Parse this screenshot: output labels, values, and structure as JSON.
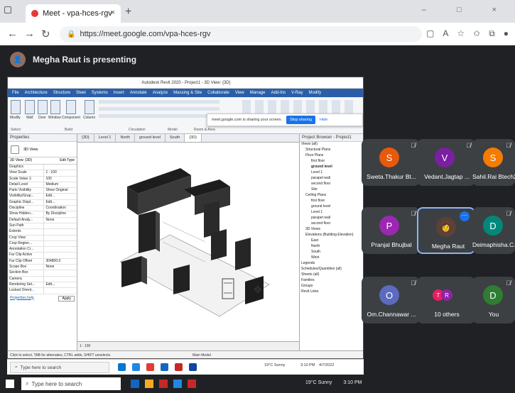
{
  "browser": {
    "tab_title": "Meet - vpa-hces-rgv",
    "tab_close": "×",
    "new_tab": "+",
    "window_controls": "– □ ×",
    "url": "https://meet.google.com/vpa-hces-rgv"
  },
  "meet": {
    "presenting_label": "Megha Raut is presenting",
    "participants": [
      {
        "name": "Sweta.Thakur Bt...",
        "initial": "S",
        "color": "#e8590c"
      },
      {
        "name": "Vedant.Jagtap ...",
        "initial": "V",
        "color": "#7b1fa2"
      },
      {
        "name": "Sahil.Rai Btech2...",
        "initial": "S",
        "color": "#f57c00"
      },
      {
        "name": "Pranjal Bhujbal",
        "initial": "P",
        "color": "#9c27b0"
      },
      {
        "name": "Megha Raut",
        "initial": "",
        "color": "#5d4037"
      },
      {
        "name": "Deimaphisha.C...",
        "initial": "D",
        "color": "#00897b"
      },
      {
        "name": "Om.Channawar ...",
        "initial": "O",
        "color": "#5c6bc0"
      },
      {
        "name": "10 others",
        "initial": "",
        "color": "#8e24aa"
      },
      {
        "name": "You",
        "initial": "D",
        "color": "#2e7d32"
      }
    ],
    "others_initials": [
      "T",
      "R"
    ]
  },
  "shared": {
    "app_title": "Autodesk Revit 2020 - Project1 - 3D View: {3D}",
    "menu": [
      "File",
      "Architecture",
      "Structure",
      "Steel",
      "Systems",
      "Insert",
      "Annotate",
      "Analyze",
      "Massing & Site",
      "Collaborate",
      "View",
      "Manage",
      "Add-Ins",
      "V-Ray",
      "Modify"
    ],
    "ribbon_buttons": [
      "Modify",
      "Wall",
      "Door",
      "Window",
      "Component",
      "Column"
    ],
    "ribbon_groups": [
      "Select",
      "Build",
      "Circulation",
      "Model",
      "Room & Area"
    ],
    "share_notice": "meet.google.com is sharing your screen.",
    "stop_sharing": "Stop sharing",
    "hide": "Hide",
    "properties_title": "Properties",
    "view_type": "3D View",
    "properties_combo": "3D View: {3D}",
    "edit_type": "Edit Type",
    "properties_rows": [
      [
        "Graphics",
        ""
      ],
      [
        "View Scale",
        "1 : 100"
      ],
      [
        "Scale Value 1:",
        "100"
      ],
      [
        "Detail Level",
        "Medium"
      ],
      [
        "Parts Visibility",
        "Show Original"
      ],
      [
        "Visibility/Grap...",
        "Edit..."
      ],
      [
        "Graphic Displ...",
        "Edit..."
      ],
      [
        "Discipline",
        "Coordination"
      ],
      [
        "Show Hidden...",
        "By Discipline"
      ],
      [
        "Default Analy...",
        "None"
      ],
      [
        "Sun Path",
        ""
      ],
      [
        "Extents",
        ""
      ],
      [
        "Crop View",
        ""
      ],
      [
        "Crop Region...",
        ""
      ],
      [
        "Annotation Cr...",
        ""
      ],
      [
        "Far Clip Active",
        ""
      ],
      [
        "Far Clip Offset",
        "304800.0"
      ],
      [
        "Scope Box",
        "None"
      ],
      [
        "Section Box",
        ""
      ],
      [
        "Camera",
        ""
      ],
      [
        "Rendering Set...",
        "Edit..."
      ],
      [
        "Locked Orient...",
        ""
      ]
    ],
    "properties_help": "Properties help",
    "apply": "Apply",
    "view_tabs": [
      "{3D}",
      "Level 1",
      "North",
      "ground level",
      "South",
      "{3D}"
    ],
    "browser_title": "Project Browser - Project1",
    "browser_items": [
      "Views (all)",
      "Structural Plans",
      "Floor Plans",
      "first floor",
      "ground level",
      "Level 1",
      "parapet wall",
      "second floor",
      "Site",
      "Ceiling Plans",
      "first floor",
      "ground level",
      "Level 1",
      "parapet wall",
      "second floor",
      "3D Views",
      "Elevations (Building Elevation)",
      "East",
      "North",
      "South",
      "West",
      "Legends",
      "Schedules/Quantities (all)",
      "Sheets (all)",
      "Families",
      "Groups",
      "Revit Links"
    ],
    "scale": "1 : 100",
    "status_text": "Click to select, TAB for alternates, CTRL adds, SHIFT unselects.",
    "status_model": "Main Model"
  },
  "taskbar": {
    "search": "Type here to search",
    "weather": "19°C Sunny",
    "time": "3:10 PM",
    "date": "4/7/2022"
  }
}
